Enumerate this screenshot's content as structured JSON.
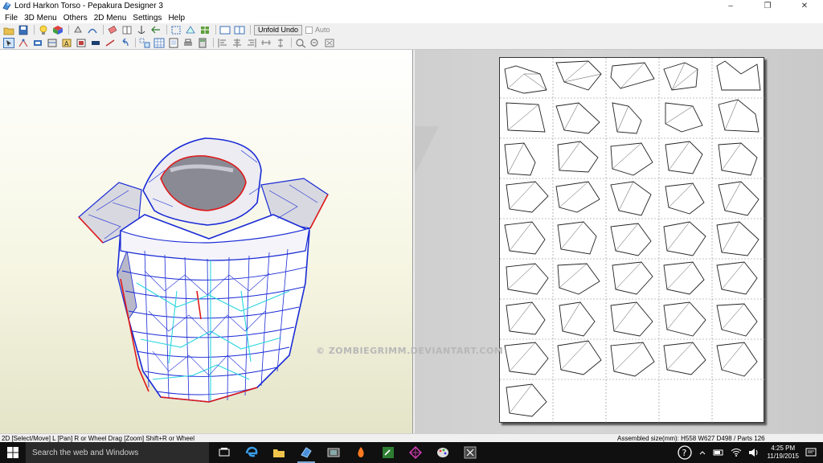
{
  "window": {
    "title": "Lord Harkon Torso - Pepakura Designer 3",
    "controls": [
      "–",
      "❐",
      "✕"
    ]
  },
  "menu": {
    "items": [
      "File",
      "3D Menu",
      "Others",
      "2D Menu",
      "Settings",
      "Help"
    ]
  },
  "toolbar": {
    "unfold_undo_label": "Unfold Undo",
    "auto_label": "Auto"
  },
  "watermark": "© ZOMBIEGRIMM.DEVIANTART.COM",
  "status": {
    "left": "2D [Select/Move] L [Pan] R or Wheel Drag [Zoom] Shift+R or Wheel",
    "right": "Assembled size(mm): H558 W627 D498 / Parts 126"
  },
  "taskbar": {
    "search_placeholder": "Search the web and Windows",
    "time": "4:25 PM",
    "date": "11/19/2015"
  },
  "colors": {
    "mesh_blue": "#1a2bd6",
    "mesh_cyan": "#2ad6e0",
    "cut_red": "#e01818",
    "taskbar": "#101010"
  }
}
